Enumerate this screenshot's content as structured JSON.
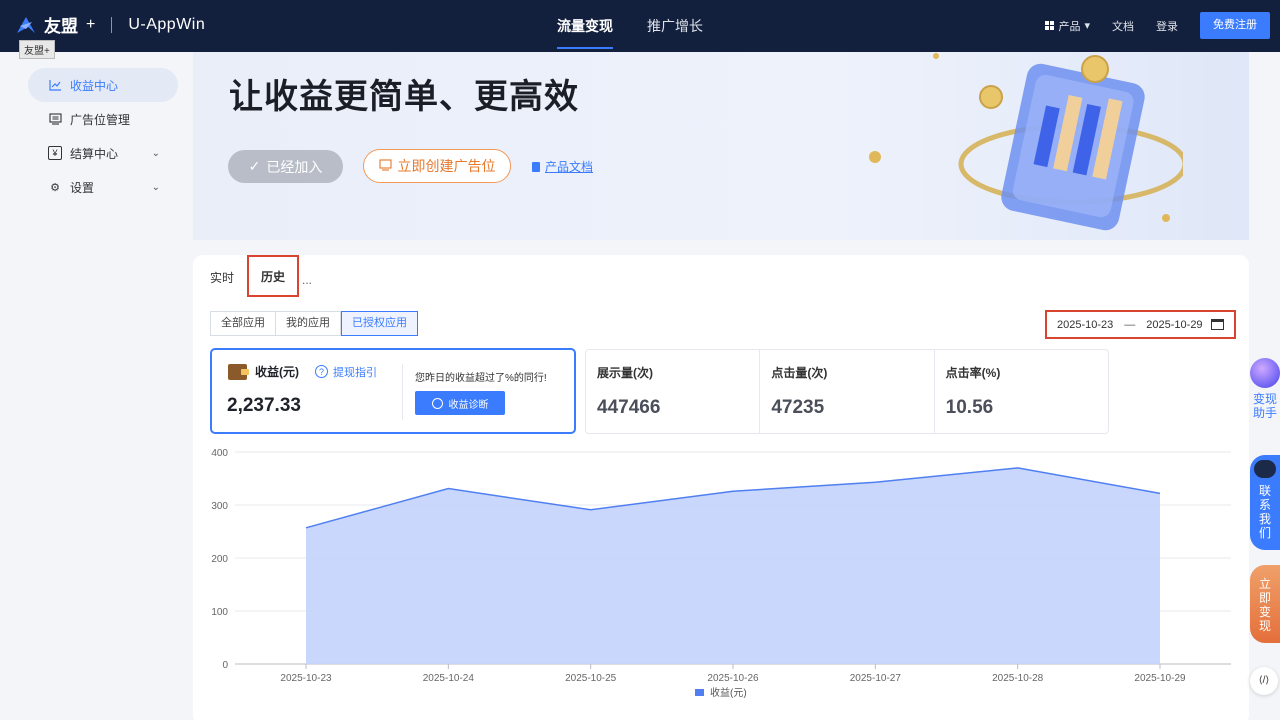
{
  "header": {
    "brand": "友盟",
    "brand_plus": "+",
    "sub_brand": "U-AppWin",
    "tooltip": "友盟+",
    "nav": [
      {
        "label": "流量变现",
        "active": true
      },
      {
        "label": "推广增长",
        "active": false
      }
    ],
    "right": {
      "product": "产品",
      "docs": "文档",
      "login": "登录",
      "register": "免费注册"
    }
  },
  "sidebar": {
    "items": [
      {
        "label": "收益中心",
        "icon": "chart-line-icon",
        "active": true
      },
      {
        "label": "广告位管理",
        "icon": "ad-slot-icon",
        "active": false
      },
      {
        "label": "结算中心",
        "icon": "yen-icon",
        "active": false,
        "expandable": true
      },
      {
        "label": "设置",
        "icon": "gear-icon",
        "active": false,
        "expandable": true
      }
    ]
  },
  "banner": {
    "title": "让收益更简单、更高效",
    "joined_label": "已经加入",
    "create_label": "立即创建广告位",
    "doc_label": "产品文档"
  },
  "tabs": {
    "realtime": "实时",
    "history": "历史",
    "more": "..."
  },
  "app_filter": {
    "options": [
      "全部应用",
      "我的应用",
      "已授权应用"
    ],
    "selected": "已授权应用"
  },
  "date_range": {
    "start": "2025-10-23",
    "separator": "—",
    "end": "2025-10-29"
  },
  "revenue_card": {
    "title": "收益(元)",
    "guide": "提现指引",
    "value": "2,237.33",
    "note": "您昨日的收益超过了%的同行!",
    "diagnose": "收益诊断"
  },
  "metrics": [
    {
      "label": "展示量(次)",
      "value": "447466"
    },
    {
      "label": "点击量(次)",
      "value": "47235"
    },
    {
      "label": "点击率(%)",
      "value": "10.56"
    }
  ],
  "chart_data": {
    "type": "area",
    "x": [
      "2025-10-23",
      "2025-10-24",
      "2025-10-25",
      "2025-10-26",
      "2025-10-27",
      "2025-10-28",
      "2025-10-29"
    ],
    "series": [
      {
        "name": "收益(元)",
        "values": [
          257,
          331,
          291,
          326,
          343,
          370,
          322
        ]
      }
    ],
    "ylim": [
      0,
      400
    ],
    "yticks": [
      0,
      100,
      200,
      300,
      400
    ],
    "grid": true,
    "legend": "bottom-center",
    "color": "#4f7ff0"
  },
  "floating": {
    "assistant": "变现助手",
    "contact": "联系我们",
    "monetize": "立即变现"
  },
  "colors": {
    "accent": "#3b7cff",
    "orange": "#e8782a",
    "header_bg": "#13203d",
    "highlight": "#d9442f"
  }
}
